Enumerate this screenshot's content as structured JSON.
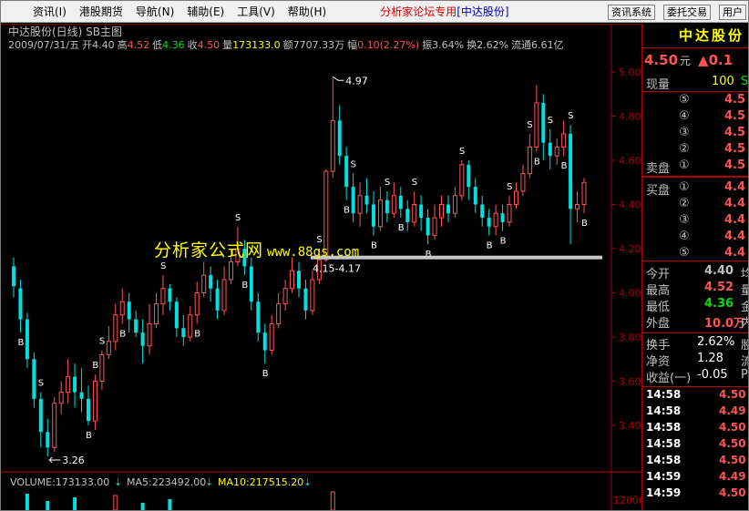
{
  "menu": {
    "items": [
      "资讯(I)",
      "港股期货",
      "导航(N)",
      "辅助(E)",
      "工具(V)",
      "帮助(H)"
    ],
    "title": "分析家论坛专用",
    "stock": "[中达股份]",
    "buttons": [
      "资讯系统",
      "委托交易",
      "用户"
    ]
  },
  "chart": {
    "title": "中达股份(日线) SB主图",
    "info": {
      "date": "2009/07/31/五",
      "open_label": "开",
      "open": "4.40",
      "high_label": "高",
      "high": "4.52",
      "low_label": "低",
      "low": "4.36",
      "close_label": "收",
      "close": "4.50",
      "vol_label": "量",
      "vol": "173133.0",
      "amount_label": "额",
      "amount": "7707.33万",
      "amp_label": "幅",
      "amp": "0.10(2.27%)",
      "swing_label": "振",
      "swing": "3.64%",
      "turnover_label": "换",
      "turnover": "2.62%",
      "float_label": "流通",
      "float": "6.61亿"
    },
    "watermark": "分析家公式网",
    "watermark_url": "www.88gs.com",
    "annotations": {
      "high": "4.97",
      "low": "3.26",
      "range": "4.15-4.17"
    },
    "volume": {
      "vol": "VOLUME:173133.00",
      "ma5": "MA5:223492.00",
      "ma10": "MA10:217515.20"
    },
    "yaxis_labels": [
      "5.00",
      "4.80",
      "4.60",
      "4.40",
      "4.20",
      "4.00",
      "3.80",
      "3.60",
      "3.40"
    ],
    "vol_axis_label": "12000"
  },
  "panel": {
    "name": "中达股份",
    "price": "4.50",
    "price_unit": "元",
    "change": "0.1",
    "now_vol_label": "现量",
    "now_vol": "100",
    "now_vol_suffix": "S",
    "asks": [
      {
        "n": "⑤",
        "p": "4.5"
      },
      {
        "n": "④",
        "p": "4.5"
      },
      {
        "n": "③",
        "p": "4.5"
      },
      {
        "n": "②",
        "p": "4.5"
      },
      {
        "n": "①",
        "p": "4.5",
        "label": "卖盘"
      }
    ],
    "bids": [
      {
        "n": "①",
        "p": "4.4",
        "label": "买盘"
      },
      {
        "n": "②",
        "p": "4.4"
      },
      {
        "n": "③",
        "p": "4.4"
      },
      {
        "n": "④",
        "p": "4.4"
      },
      {
        "n": "⑤",
        "p": "4.4"
      }
    ],
    "stats": [
      {
        "label": "今开",
        "value": "4.40",
        "tail": "均",
        "color": "#c0c0c0"
      },
      {
        "label": "最高",
        "value": "4.52",
        "tail": "量",
        "color": "#ff5454"
      },
      {
        "label": "最低",
        "value": "4.36",
        "tail": "金",
        "color": "#00e000"
      },
      {
        "label": "外盘",
        "value": "10.0万",
        "tail": "内",
        "color": "#ff5454"
      }
    ],
    "stats2": [
      {
        "label": "换手",
        "value": "2.62%",
        "tail": "股"
      },
      {
        "label": "净资",
        "value": "1.28",
        "tail": "流"
      },
      {
        "label": "收益(一)",
        "value": "-0.05",
        "tail": "P"
      }
    ],
    "ticks": [
      {
        "t": "14:58",
        "p": "4.50",
        "c": "#ff5454"
      },
      {
        "t": "14:58",
        "p": "4.49",
        "c": "#ff5454"
      },
      {
        "t": "14:58",
        "p": "4.50",
        "c": "#ff5454"
      },
      {
        "t": "14:58",
        "p": "4.50",
        "c": "#ff5454"
      },
      {
        "t": "14:58",
        "p": "4.50",
        "c": "#ff5454"
      },
      {
        "t": "14:59",
        "p": "4.49",
        "c": "#ff5454"
      },
      {
        "t": "14:59",
        "p": "4.50",
        "c": "#ff5454"
      }
    ]
  },
  "colors": {
    "up": "#ff5454",
    "down": "#00e0e0",
    "marker": "#ffffff",
    "watermark": "#ffff00"
  }
}
